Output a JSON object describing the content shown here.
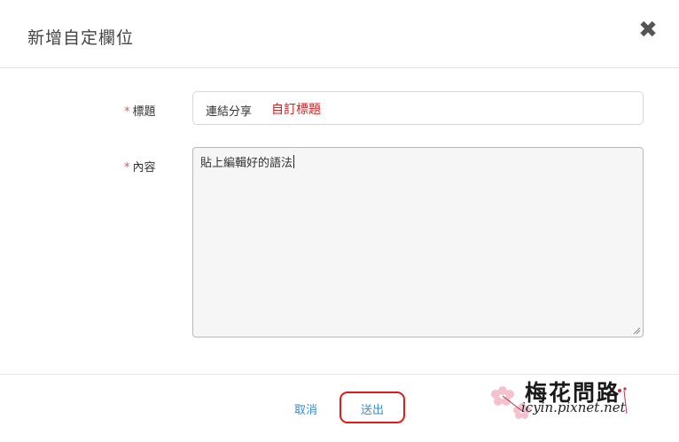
{
  "dialog": {
    "title": "新增自定欄位",
    "close_symbol": "✖"
  },
  "form": {
    "required_mark": "*",
    "title_label": "標題",
    "title_value": "連結分享",
    "title_annotation": "自訂標題",
    "content_label": "內容",
    "content_value": "貼上編輯好的語法"
  },
  "footer": {
    "cancel_label": "取消",
    "submit_label": "送出"
  },
  "watermark": {
    "title": "梅花問路",
    "url": "icyin.pixnet.net"
  },
  "colors": {
    "accent": "#3a8bd1",
    "required": "#d9534f",
    "highlight": "#e01919"
  }
}
